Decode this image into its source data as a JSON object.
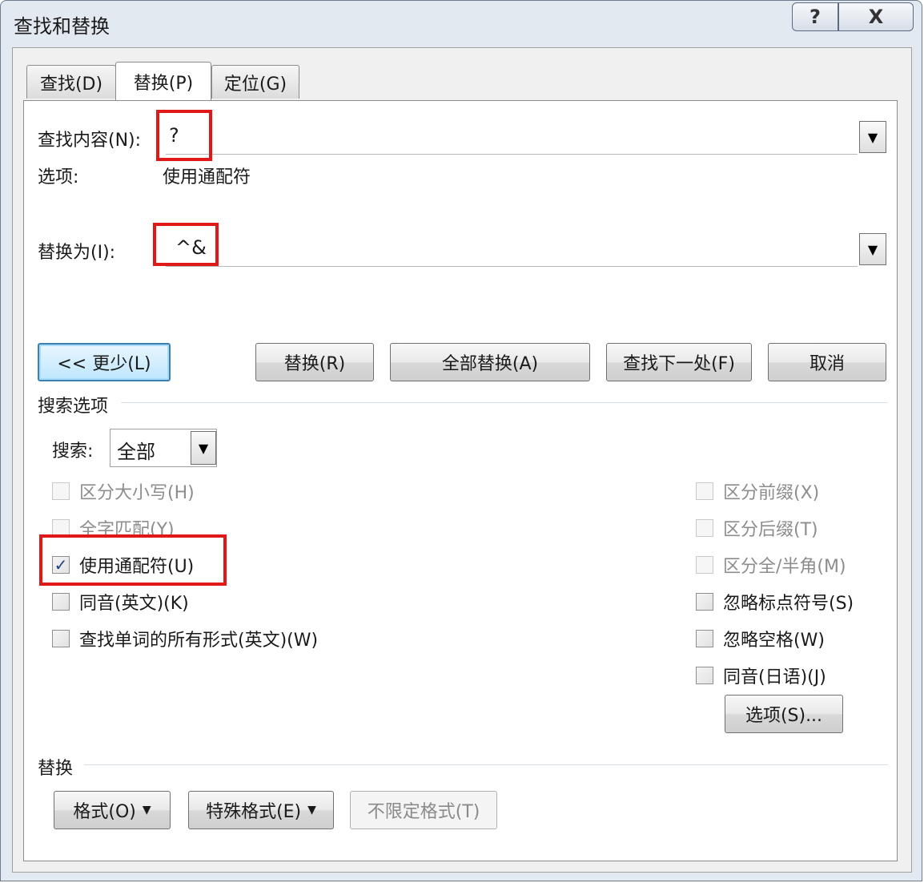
{
  "dialog": {
    "title": "查找和替换",
    "help_button": "?",
    "close_button": "X"
  },
  "tabs": [
    {
      "label": "查找(D)"
    },
    {
      "label": "替换(P)"
    },
    {
      "label": "定位(G)"
    }
  ],
  "find": {
    "label": "查找内容(N):",
    "value": "?",
    "options_label": "选项:",
    "options_value": "使用通配符"
  },
  "replace": {
    "label": "替换为(I):",
    "value": "^&"
  },
  "buttons": {
    "less": "<< 更少(L)",
    "replace": "替换(R)",
    "replace_all": "全部替换(A)",
    "find_next": "查找下一处(F)",
    "cancel": "取消"
  },
  "search_options": {
    "title": "搜索选项",
    "search_label": "搜索:",
    "search_value": "全部",
    "left": [
      {
        "label": "区分大小写(H)",
        "checked": false,
        "enabled": false
      },
      {
        "label": "全字匹配(Y)",
        "checked": false,
        "enabled": false
      },
      {
        "label": "使用通配符(U)",
        "checked": true,
        "enabled": true
      },
      {
        "label": "同音(英文)(K)",
        "checked": false,
        "enabled": true
      },
      {
        "label": "查找单词的所有形式(英文)(W)",
        "checked": false,
        "enabled": true
      }
    ],
    "right": [
      {
        "label": "区分前缀(X)",
        "checked": false,
        "enabled": false
      },
      {
        "label": "区分后缀(T)",
        "checked": false,
        "enabled": false
      },
      {
        "label": "区分全/半角(M)",
        "checked": false,
        "enabled": false
      },
      {
        "label": "忽略标点符号(S)",
        "checked": false,
        "enabled": true
      },
      {
        "label": "忽略空格(W)",
        "checked": false,
        "enabled": true
      },
      {
        "label": "同音(日语)(J)",
        "checked": false,
        "enabled": true
      }
    ],
    "options_button": "选项(S)..."
  },
  "replace_section": {
    "title": "替换",
    "format_button": "格式(O)",
    "special_button": "特殊格式(E)",
    "no_format_button": "不限定格式(T)"
  },
  "colors": {
    "highlight": "#e01818",
    "checkmark": "#1f3e88"
  }
}
